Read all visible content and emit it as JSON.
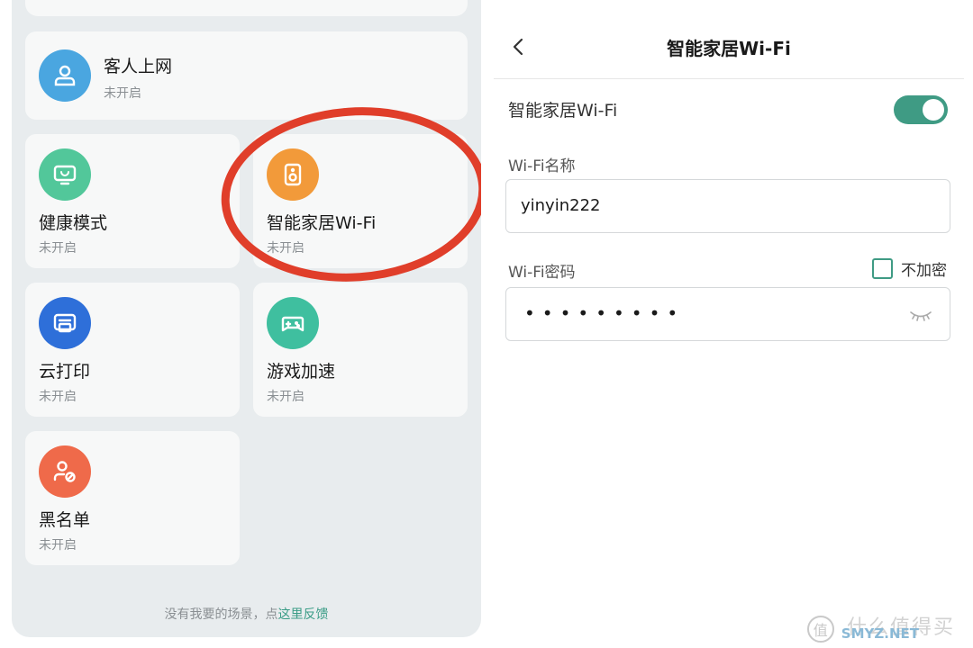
{
  "left": {
    "guest": {
      "title": "客人上网",
      "status": "未开启",
      "color": "#4aa6e0"
    },
    "tiles": [
      {
        "id": "health",
        "title": "健康模式",
        "status": "未开启",
        "color": "#52c79a",
        "icon": "monitor-icon"
      },
      {
        "id": "smart",
        "title": "智能家居Wi-Fi",
        "status": "未开启",
        "color": "#f29a3a",
        "icon": "speaker-icon"
      },
      {
        "id": "print",
        "title": "云打印",
        "status": "未开启",
        "color": "#2e6fd9",
        "icon": "printer-icon"
      },
      {
        "id": "game",
        "title": "游戏加速",
        "status": "未开启",
        "color": "#3fbf9f",
        "icon": "gamepad-icon"
      },
      {
        "id": "black",
        "title": "黑名单",
        "status": "未开启",
        "color": "#ef6a4a",
        "icon": "user-block-icon"
      }
    ],
    "feedback": {
      "text": "没有我要的场景，点",
      "link": "这里反馈"
    },
    "highlight_color": "#e03e2a"
  },
  "right": {
    "title": "智能家居Wi-Fi",
    "toggle_label": "智能家居Wi-Fi",
    "toggle_on": true,
    "name_label": "Wi-Fi名称",
    "name_value": "yinyin222",
    "pwd_label": "Wi-Fi密码",
    "pwd_mask": "•••••••••",
    "no_encrypt_label": "不加密",
    "accent_color": "#3f9b84"
  },
  "watermark": {
    "cn": "什么值得买",
    "en": "SMYZ.NET",
    "logo": "值"
  }
}
